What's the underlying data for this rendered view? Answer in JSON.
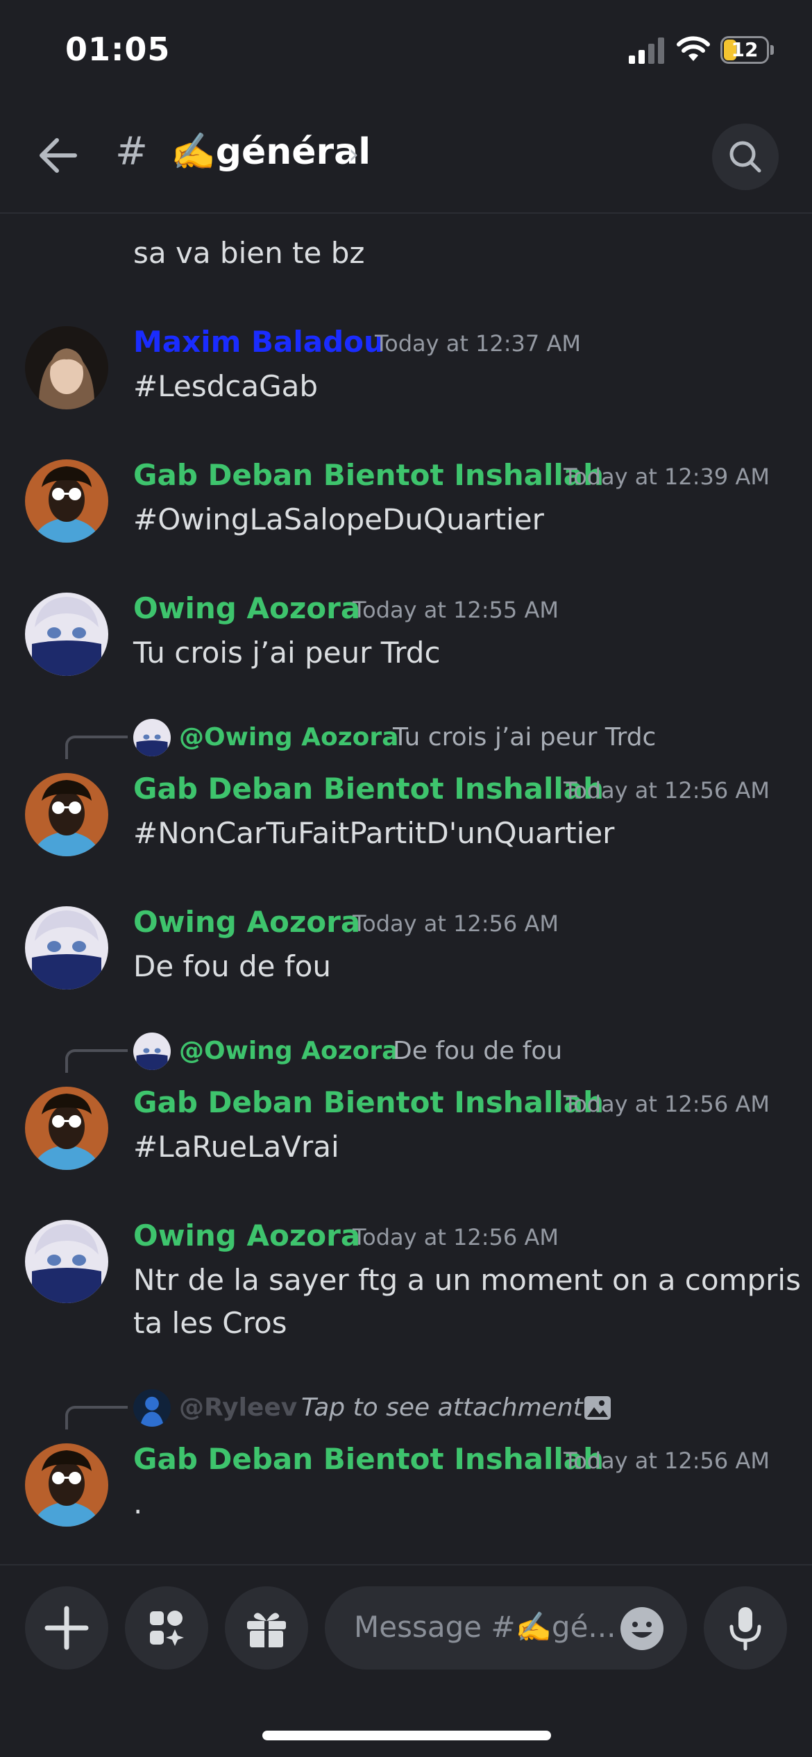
{
  "status_bar": {
    "time": "01:05",
    "battery": "12"
  },
  "header": {
    "hash": "#",
    "channel": "✍️général",
    "chevron": "›"
  },
  "messages": {
    "m0": {
      "text": "sa va bien te bz"
    },
    "m1": {
      "author": "Maxim Baladou",
      "time": "Today at 12:37 AM",
      "text": "#LesdcaGab"
    },
    "m2": {
      "author": "Gab Deban Bientot Inshallah",
      "time": "Today at 12:39 AM",
      "text": "#OwingLaSalopeDuQuartier"
    },
    "m3": {
      "author": "Owing Aozora",
      "time": "Today at 12:55 AM",
      "text": "Tu crois j’ai peur Trdc"
    },
    "m4": {
      "reply_author": "@Owing Aozora",
      "reply_text": "Tu crois j’ai peur Trdc",
      "author": "Gab Deban Bientot Inshallah",
      "time": "Today at 12:56 AM",
      "text": "#NonCarTuFaitPartitD'unQuartier"
    },
    "m5": {
      "author": "Owing Aozora",
      "time": "Today at 12:56 AM",
      "text": "De fou de fou"
    },
    "m6": {
      "reply_author": "@Owing Aozora",
      "reply_text": "De fou de fou",
      "author": "Gab Deban Bientot Inshallah",
      "time": "Today at 12:56 AM",
      "text": "#LaRueLaVrai"
    },
    "m7": {
      "author": "Owing Aozora",
      "time": "Today at 12:56 AM",
      "text_line1": "Ntr de la sayer ftg a un moment on a compris",
      "text_line2": "ta les Cros"
    },
    "m8": {
      "reply_author": "@Ryleev",
      "reply_text": "Tap to see attachment",
      "author": "Gab Deban Bientot Inshallah",
      "time": "Today at 12:56 AM",
      "text": "."
    }
  },
  "composer": {
    "placeholder": "Message #✍️gé..."
  },
  "icons": {
    "back": "arrow-left-icon",
    "search": "search-icon",
    "plus": "plus-icon",
    "apps": "apps-icon",
    "gift": "gift-icon",
    "emoji": "emoji-icon",
    "mic": "microphone-icon",
    "attachment": "image-icon"
  },
  "colors": {
    "background": "#1e1f24",
    "green_role": "#3ec46d",
    "blue_role": "#1a2cff",
    "surface": "#2b2d33"
  }
}
